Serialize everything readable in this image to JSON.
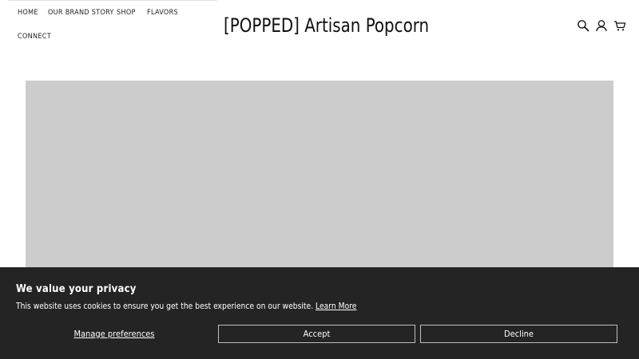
{
  "nav": {
    "items": [
      {
        "label": "HOME"
      },
      {
        "label": "OUR BRAND STORY"
      },
      {
        "label": "SHOP"
      },
      {
        "label": "FLAVORS"
      },
      {
        "label": "CONNECT"
      }
    ]
  },
  "header": {
    "logo": "[POPPED] Artisan Popcorn"
  },
  "icons": {
    "search": "search-icon",
    "account": "account-icon",
    "cart": "cart-icon"
  },
  "hero": {
    "placeholder_color": "#cccccc"
  },
  "cookie": {
    "title": "We value your privacy",
    "message": "This website uses cookies to ensure you get the best experience on our website.",
    "learn_more": "Learn More",
    "manage_label": "Manage preferences",
    "accept_label": "Accept",
    "decline_label": "Decline",
    "background": "#242424"
  }
}
